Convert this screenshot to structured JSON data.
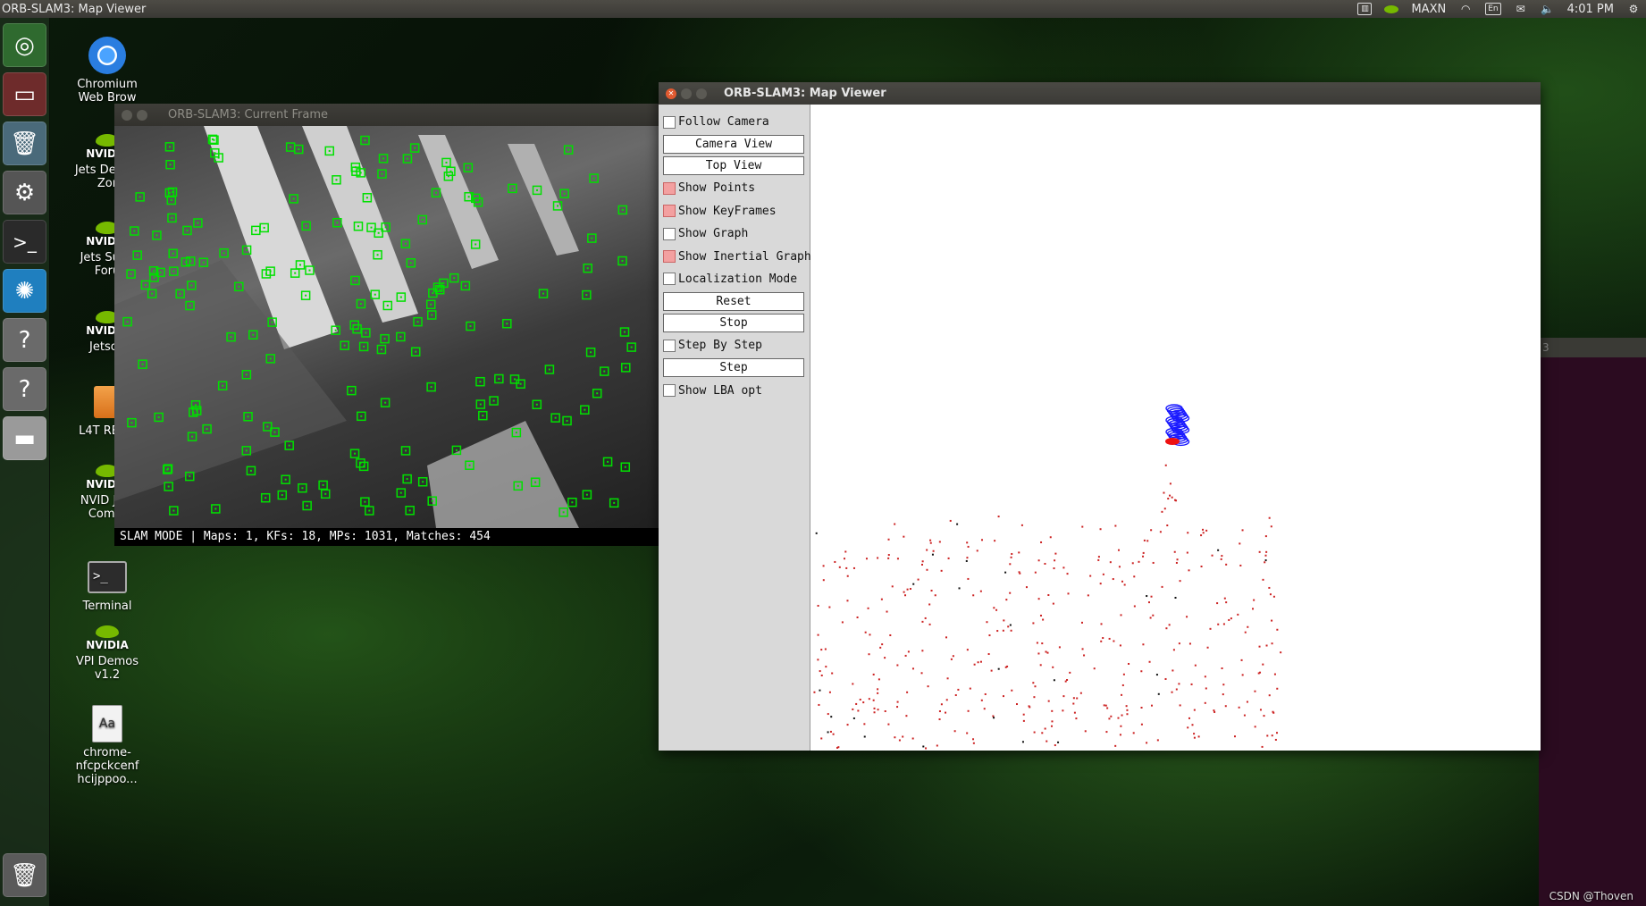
{
  "top_panel": {
    "title": "ORB-SLAM3: Map Viewer",
    "power_mode": "MAXN",
    "keyboard": "En",
    "clock": "4:01 PM",
    "icons": [
      "nvidia-icon",
      "wifi-icon",
      "mail-icon",
      "volume-icon",
      "gear-icon"
    ]
  },
  "launcher": {
    "items": [
      "ubuntu-dash-icon",
      "files-icon",
      "software-center-icon",
      "system-settings-icon",
      "terminal-icon",
      "browser-icon",
      "help-icon",
      "help-icon",
      "drive-icon",
      "trash-icon"
    ]
  },
  "desktop": {
    "icons": [
      {
        "label": "Chromium Web Brow",
        "icon": "chromium-icon"
      },
      {
        "label": "Jets Develc Zor",
        "icon": "nvidia-icon"
      },
      {
        "label": "Jets Supp Foru",
        "icon": "nvidia-icon"
      },
      {
        "label": "Jetson",
        "icon": "nvidia-icon"
      },
      {
        "label": "L4T READ",
        "icon": "folder-icon"
      },
      {
        "label": "NVID Jets Comm",
        "icon": "nvidia-icon"
      },
      {
        "label": "Terminal",
        "icon": "terminal-icon"
      },
      {
        "label": "VPI Demos v1.2",
        "icon": "nvidia-icon"
      },
      {
        "label": "chrome-nfcpckcenf hcijppoo...",
        "icon": "document-icon"
      }
    ],
    "nvidia_text": "NVIDIA"
  },
  "current_frame": {
    "title": "ORB-SLAM3: Current Frame",
    "status": "SLAM MODE |  Maps: 1, KFs: 18, MPs: 1031, Matches: 454",
    "feature_color": "#00e000"
  },
  "map_viewer": {
    "title": "ORB-SLAM3: Map Viewer",
    "controls": {
      "follow_camera": "Follow Camera",
      "camera_view": "Camera View",
      "top_view": "Top View",
      "show_points": "Show Points",
      "show_keyframes": "Show KeyFrames",
      "show_graph": "Show Graph",
      "show_inertial_graph": "Show Inertial Graph",
      "localization_mode": "Localization Mode",
      "reset": "Reset",
      "stop": "Stop",
      "step_by_step": "Step By Step",
      "step": "Step",
      "show_lba_opt": "Show LBA opt"
    },
    "checked": {
      "follow_camera": false,
      "show_points": true,
      "show_keyframes": true,
      "show_graph": false,
      "show_inertial_graph": true,
      "localization_mode": false,
      "step_by_step": false,
      "show_lba_opt": false
    },
    "colors": {
      "map_points": "#cc2222",
      "keyframes": "#1a1aff",
      "current_camera": "#ee1111"
    }
  },
  "right_window": {
    "title_fragment": "3"
  },
  "watermark": "CSDN @Thoven"
}
